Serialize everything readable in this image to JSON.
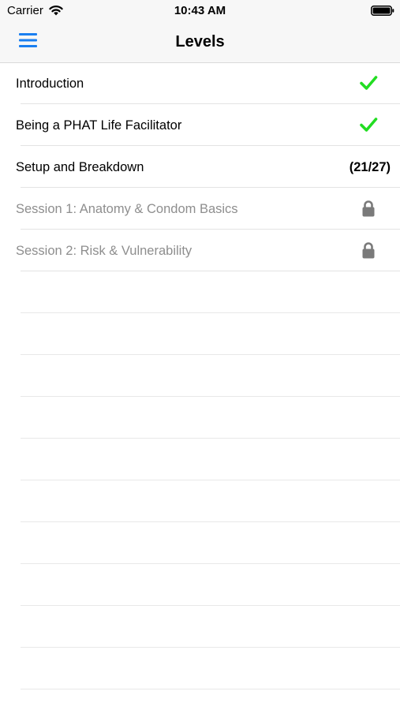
{
  "status_bar": {
    "carrier": "Carrier",
    "time": "10:43 AM",
    "wifi_icon": "wifi-icon",
    "battery_icon": "battery-icon"
  },
  "nav": {
    "title": "Levels",
    "menu_icon": "hamburger-menu-icon",
    "accent_color": "#1a7ff0"
  },
  "levels": [
    {
      "title": "Introduction",
      "status": "completed",
      "icon": "checkmark-icon"
    },
    {
      "title": "Being a PHAT Life Facilitator",
      "status": "completed",
      "icon": "checkmark-icon"
    },
    {
      "title": "Setup and Breakdown",
      "status": "in-progress",
      "progress": "(21/27)"
    },
    {
      "title": "Session 1: Anatomy & Condom Basics",
      "status": "locked",
      "icon": "lock-icon"
    },
    {
      "title": "Session 2: Risk & Vulnerability",
      "status": "locked",
      "icon": "lock-icon"
    }
  ],
  "colors": {
    "check": "#22dd22",
    "lock": "#7a7a7a",
    "locked_text": "#8e8e8e"
  }
}
